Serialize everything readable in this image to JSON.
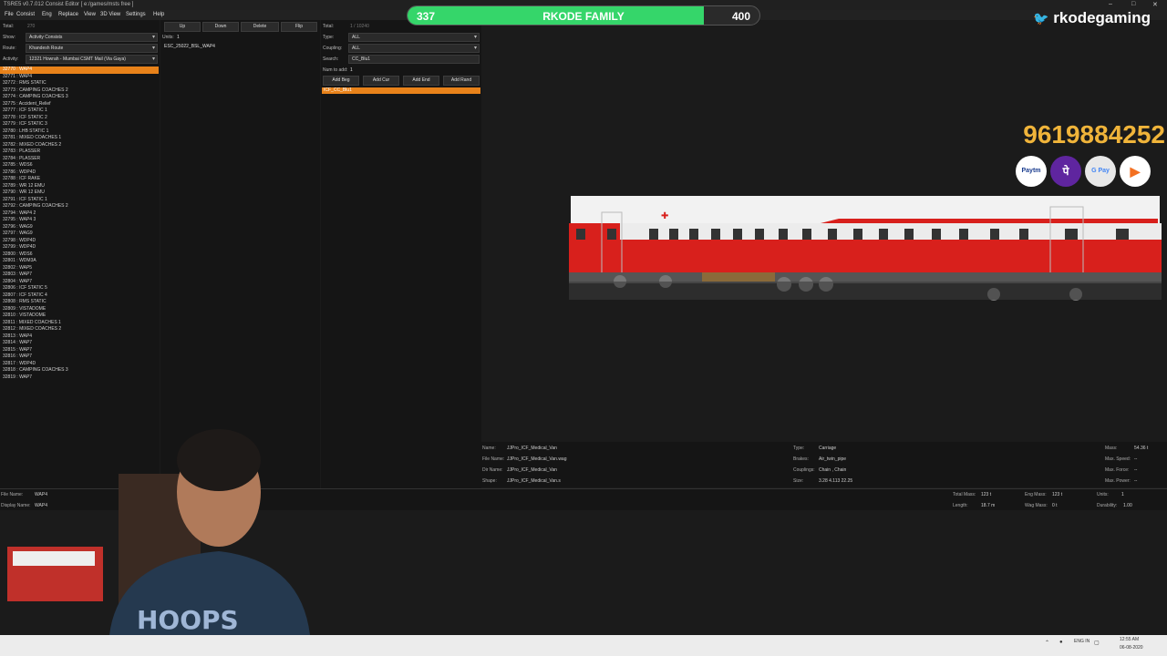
{
  "window": {
    "title": "TSRE5 v0.7.012 Consist Editor [ e:/games/msts free ]",
    "controls": [
      "–",
      "□",
      "✕"
    ]
  },
  "menu": [
    "File",
    "Consist",
    "Eng",
    "Replace",
    "View",
    "3D View",
    "Settings",
    "Help"
  ],
  "left_panel": {
    "total_label": "Total:",
    "total_value": "270",
    "show_label": "Show:",
    "show_value": "Activity Consists",
    "route_label": "Route:",
    "route_value": "Khandesh Route",
    "activity_label": "Activity:",
    "activity_value": "12321 Howrah - Mumbai CSMT Mail (Via Gaya)",
    "consists": [
      "32770 : WAP4",
      "32771 : WAP4",
      "32772 : RMS STATIC",
      "32773 : CAMPING COACHES 2",
      "32774 : CAMPING COACHES 3",
      "32775 : Accident_Relief",
      "32777 : ICF STATIC 1",
      "32778 : ICF STATIC 2",
      "32779 : ICF STATIC 3",
      "32780 : LHB STATIC 1",
      "32781 : MIXED COACHES 1",
      "32782 : MIXED COACHES 2",
      "32783 : PLASSER",
      "32784 : PLASSER",
      "32785 : WDS6",
      "32786 : WDP4D",
      "32788 : ICF RAKE",
      "32789 : WR 12 EMU",
      "32790 : WR 12 EMU",
      "32791 : ICF STATIC 1",
      "32792 : CAMPING COACHES 2",
      "32794 : WAP4 2",
      "32795 : WAP4 3",
      "32796 : WAG9",
      "32797 : WAG9",
      "32798 : WDP4D",
      "32799 : WDP4D",
      "32800 : WDS6",
      "32801 : WDM3A",
      "32802 : WAP5",
      "32803 : WAP7",
      "32804 : WAP7",
      "32806 : ICF STATIC 5",
      "32807 : ICF STATIC 4",
      "32808 : RMS STATIC",
      "32809 : VISTADOME",
      "32810 : VISTADOME",
      "32811 : MIXED COACHES 1",
      "32812 : MIXED COACHES 2",
      "32813 : WAP4",
      "32814 : WAP7",
      "32815 : WAP7",
      "32816 : WAP7",
      "32817 : WDP4D",
      "32818 : CAMPING COACHES 3",
      "32819 : WAP7"
    ],
    "selected_index": 0
  },
  "mid_panel": {
    "buttons": [
      "Up",
      "Down",
      "Delete",
      "Flip"
    ],
    "units_label": "Units:",
    "units_value": "1",
    "unit_item": "ESC_25022_BSL_WAP4"
  },
  "right_panel": {
    "total_label": "Total:",
    "total_value": "1 / 10240",
    "type_label": "Type:",
    "type_value": "ALL",
    "coupling_label": "Coupling:",
    "coupling_value": "ALL",
    "search_label": "Search:",
    "search_value": "CC_Blu1",
    "num_label": "Num to add:",
    "num_value": "1",
    "buttons": [
      "Add Beg",
      "Add Cur",
      "Add End",
      "Add Rand"
    ],
    "result_item": "ICF_CC_Blu1"
  },
  "overlay": {
    "counter_current": "337",
    "counter_label": "RKODE FAMILY",
    "counter_target": "400",
    "counter_fraction": 0.8425,
    "twitter_handle": "rkodegaming",
    "phone": "9619884252",
    "pay_icons": [
      "paytm-icon",
      "phonepe-icon",
      "gpay-icon",
      "bhim-icon"
    ],
    "pay_labels": [
      "Paytm",
      "पे",
      "G Pay",
      "▶"
    ]
  },
  "coach_info": {
    "name_label": "Name:",
    "name_value": "JJPro_ICF_Medical_Van",
    "file_label": "File Name:",
    "file_value": "JJPro_ICF_Medical_Van.wag",
    "dir_label": "Dir Name:",
    "dir_value": "JJPro_ICF_Medical_Van",
    "shape_label": "Shape:",
    "shape_value": "JJPro_ICF_Medical_Van.s",
    "type_label": "Type:",
    "type_value": "Carriage",
    "brakes_label": "Brakes:",
    "brakes_value": "Air_twin_pipe",
    "couplings_label": "Couplings:",
    "couplings_value": "Chain , Chain",
    "size_label": "Size:",
    "size_value": "3.28 4.113 22.25",
    "mass_label": "Mass:",
    "mass_value": "54.36 t",
    "maxspeed_label": "Max. Speed:",
    "maxspeed_value": "--",
    "maxforce_label": "Max. Force:",
    "maxforce_value": "--",
    "maxpower_label": "Max. Power:",
    "maxpower_value": "--"
  },
  "bottom": {
    "file_name_label": "File Name:",
    "file_name_value": "WAP4",
    "display_name_label": "Display Name:",
    "display_name_value": "WAP4",
    "total_mass_label": "Total Mass:",
    "total_mass_value": "123 t",
    "eng_mass_label": "Eng Mass:",
    "eng_mass_value": "123 t",
    "units_label": "Units:",
    "units_value": "1",
    "length_label": "Length:",
    "length_value": "18.7 m",
    "wag_mass_label": "Wag Mass:",
    "wag_mass_value": "0 t",
    "durability_label": "Durability:",
    "durability_value": "1.00"
  },
  "taskbar": {
    "lang": "ENG IN",
    "time": "12:55 AM",
    "date": "06-08-2020"
  },
  "colors": {
    "accent": "#e8821a",
    "counter_fill": "#35d66a",
    "phone": "#f0b43a",
    "coach_red": "#d8201c"
  }
}
